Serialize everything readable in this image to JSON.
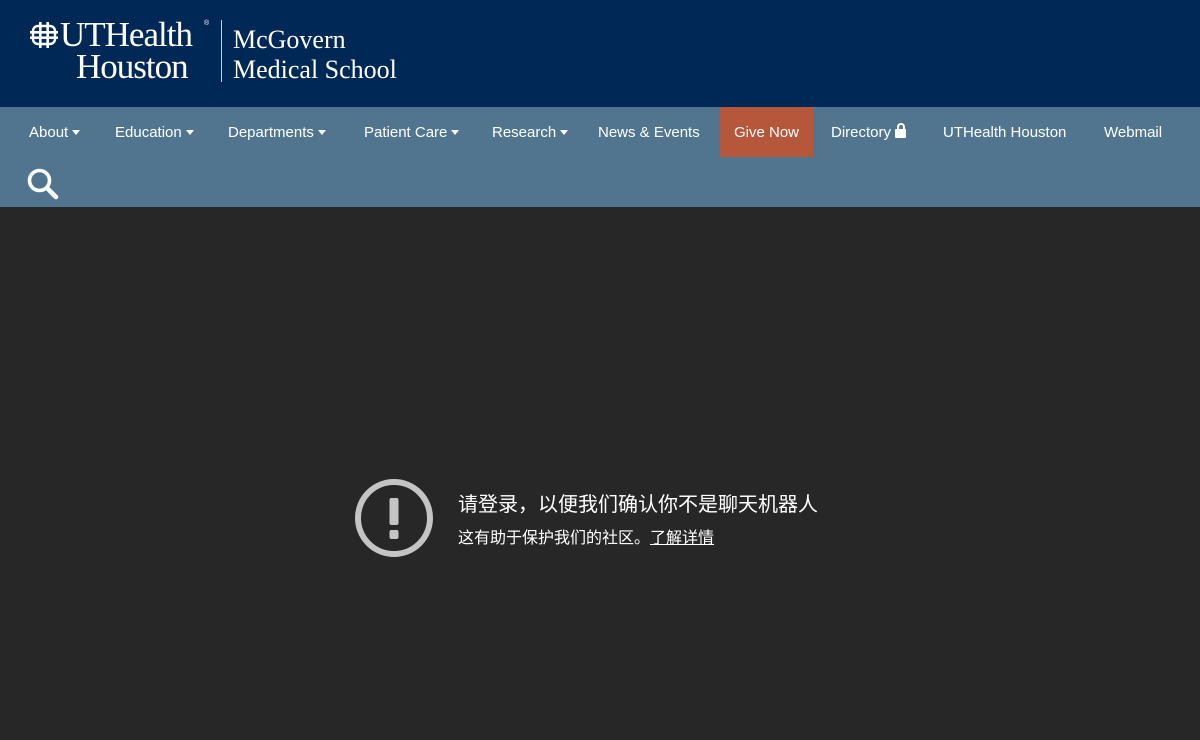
{
  "brand": {
    "line1": "UTHealth",
    "registered": "®",
    "line2": "Houston",
    "school_line1": "McGovern",
    "school_line2": "Medical School"
  },
  "nav": {
    "items": [
      {
        "label": "About",
        "dropdown": true
      },
      {
        "label": "Education",
        "dropdown": true
      },
      {
        "label": "Departments",
        "dropdown": true
      },
      {
        "label": "Patient Care",
        "dropdown": true
      },
      {
        "label": "Research",
        "dropdown": true
      },
      {
        "label": "News & Events",
        "dropdown": false
      },
      {
        "label": "Give Now",
        "dropdown": false,
        "highlight": true
      },
      {
        "label": "Directory",
        "dropdown": false,
        "icon": "lock-icon"
      },
      {
        "label": "UTHealth Houston",
        "dropdown": false
      },
      {
        "label": "Webmail",
        "dropdown": false
      }
    ],
    "search_icon": "search-icon"
  },
  "notice": {
    "icon": "exclamation-circle-icon",
    "title": "请登录，以便我们确认你不是聊天机器人",
    "text": "这有助于保护我们的社区。",
    "link_label": "了解详情"
  },
  "colors": {
    "header_bg": "#002856",
    "nav_bg": "#52758f",
    "give_bg": "#b4573b",
    "page_bg": "#272727",
    "icon_gray": "#c4c4c4"
  }
}
